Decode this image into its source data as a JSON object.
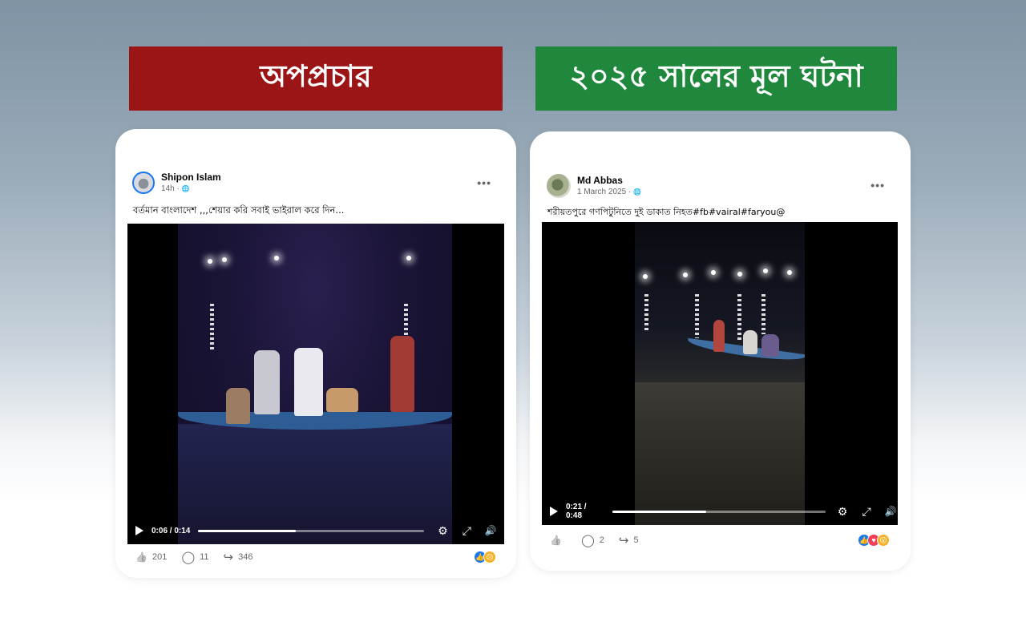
{
  "banners": {
    "left": {
      "text": "অপপ্রচার",
      "color": "#9b1516"
    },
    "right": {
      "text": "২০২৫ সালের মূল ঘটনা",
      "color": "#1f883d"
    }
  },
  "posts": {
    "left": {
      "author": "Shipon Islam",
      "time": "14h",
      "caption": "বর্তমান বাংলাদেশ ,,,শেয়ার করি সবাই ভাইরাল করে দিন...",
      "video": {
        "timecode": "0:06 / 0:14",
        "progress_fraction": 0.43
      },
      "likes": "201",
      "comments": "11",
      "shares": "346",
      "reactions": [
        "like-icon",
        "sad-icon"
      ]
    },
    "right": {
      "author": "Md Abbas",
      "time": "1 March 2025",
      "caption": "শরীয়তপুরে গণপিটুনিতে দুই ডাকাত নিহত#fb#vairal#faryou@",
      "video": {
        "timecode": "0:21 / 0:48",
        "progress_fraction": 0.44
      },
      "likes": "",
      "comments": "2",
      "shares": "5",
      "reactions": [
        "like-icon",
        "love-icon",
        "wow-icon"
      ]
    }
  },
  "icons": {
    "globe": "🌐",
    "more": "•••",
    "like": "👍",
    "comment": "◯",
    "share": "↪",
    "settings": "⚙",
    "fullscreen": "⤢",
    "volume": "🔊"
  },
  "colors": {
    "facebook_blue": "#1877f2",
    "love_red": "#f33e58",
    "sad_yellow": "#f7b125"
  }
}
